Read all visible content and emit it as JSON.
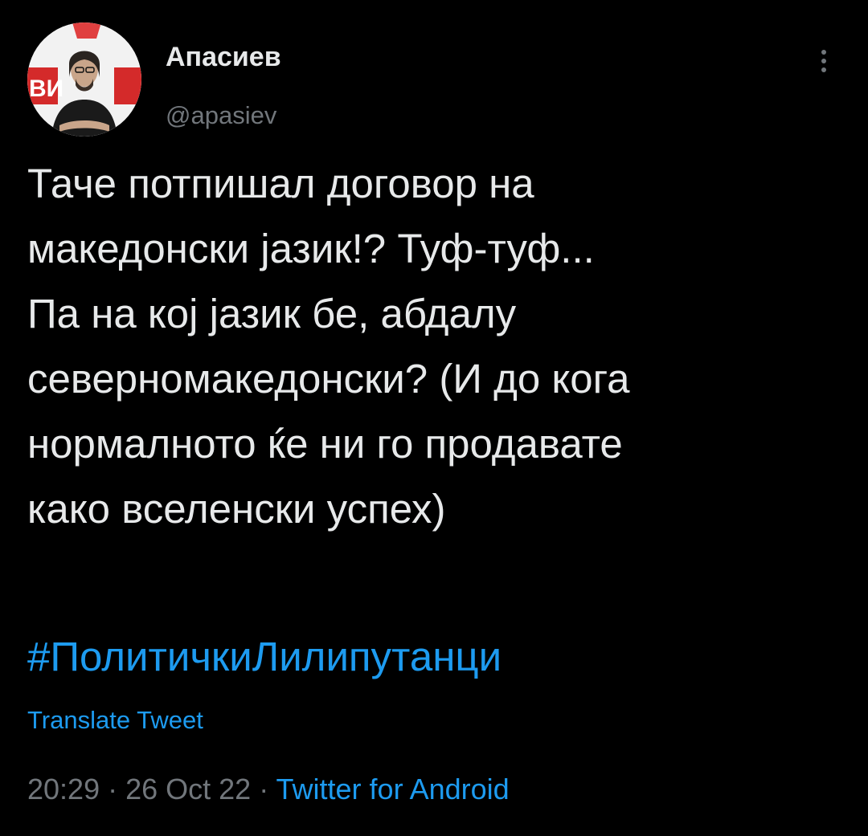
{
  "author": {
    "display_name": "Апасиев",
    "handle": "@apasiev",
    "avatar_icon": "profile-photo"
  },
  "more_options_icon": "more-vertical-icon",
  "tweet": {
    "text": "Тачe потпишал договор на\nмакедонски јазик!? Туф-туф...\nПа на кој јазик бе, абдалу\nсеверномакедонски? (И до кога\nнормалното ќе ни го продавате\nкако вселенски успех)",
    "hashtag": "#ПолитичкиЛилипутанци",
    "translate_label": "Translate Tweet",
    "time": "20:29",
    "date": "26 Oct 22",
    "separator": " · ",
    "source": "Twitter for Android"
  },
  "colors": {
    "background": "#000000",
    "text": "#e7e9ea",
    "secondary": "#71767b",
    "link": "#1d9bf0"
  }
}
